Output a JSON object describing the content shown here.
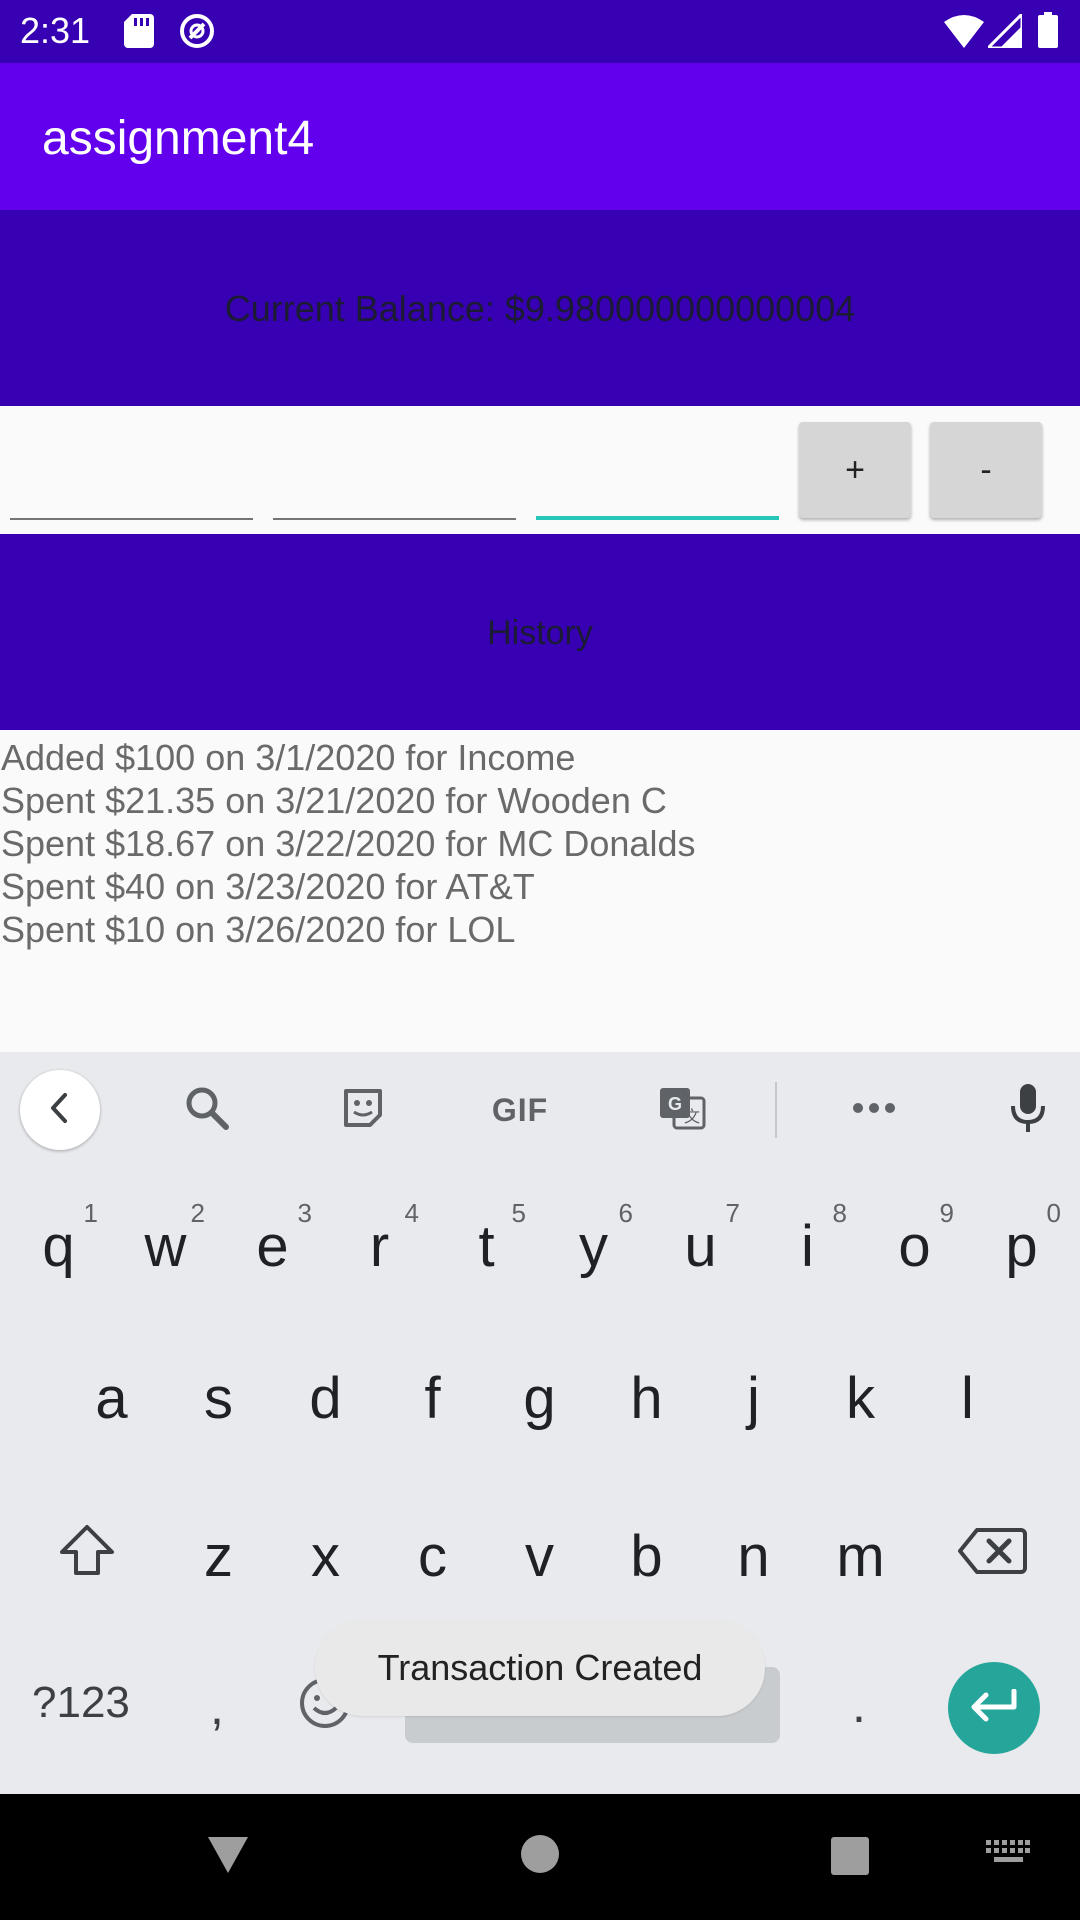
{
  "status_bar": {
    "time": "2:31"
  },
  "app_bar": {
    "title": "assignment4"
  },
  "balance": {
    "text": "Current Balance: $9.980000000000004"
  },
  "form": {
    "field1_value": "",
    "field2_value": "",
    "field3_value": "",
    "add_label": "+",
    "subtract_label": "-"
  },
  "history": {
    "header": "History",
    "items": [
      "Added $100 on 3/1/2020 for Income",
      "Spent $21.35 on 3/21/2020 for Wooden C",
      "Spent $18.67 on 3/22/2020 for MC Donalds",
      "Spent $40 on 3/23/2020 for AT&T",
      "Spent $10 on 3/26/2020 for LOL"
    ]
  },
  "keyboard": {
    "gif_label": "GIF",
    "row1": [
      "q",
      "w",
      "e",
      "r",
      "t",
      "y",
      "u",
      "i",
      "o",
      "p"
    ],
    "row1_hints": [
      "1",
      "2",
      "3",
      "4",
      "5",
      "6",
      "7",
      "8",
      "9",
      "0"
    ],
    "row2": [
      "a",
      "s",
      "d",
      "f",
      "g",
      "h",
      "j",
      "k",
      "l"
    ],
    "row3": [
      "z",
      "x",
      "c",
      "v",
      "b",
      "n",
      "m"
    ],
    "symbols_label": "?123",
    "comma_label": ",",
    "period_label": "."
  },
  "toast": {
    "message": "Transaction Created"
  },
  "colors": {
    "status_bar": "#3700b3",
    "app_bar": "#6200ee",
    "panel": "#3700b3",
    "accent": "#26c6b8",
    "enter_key": "#26a69a"
  }
}
